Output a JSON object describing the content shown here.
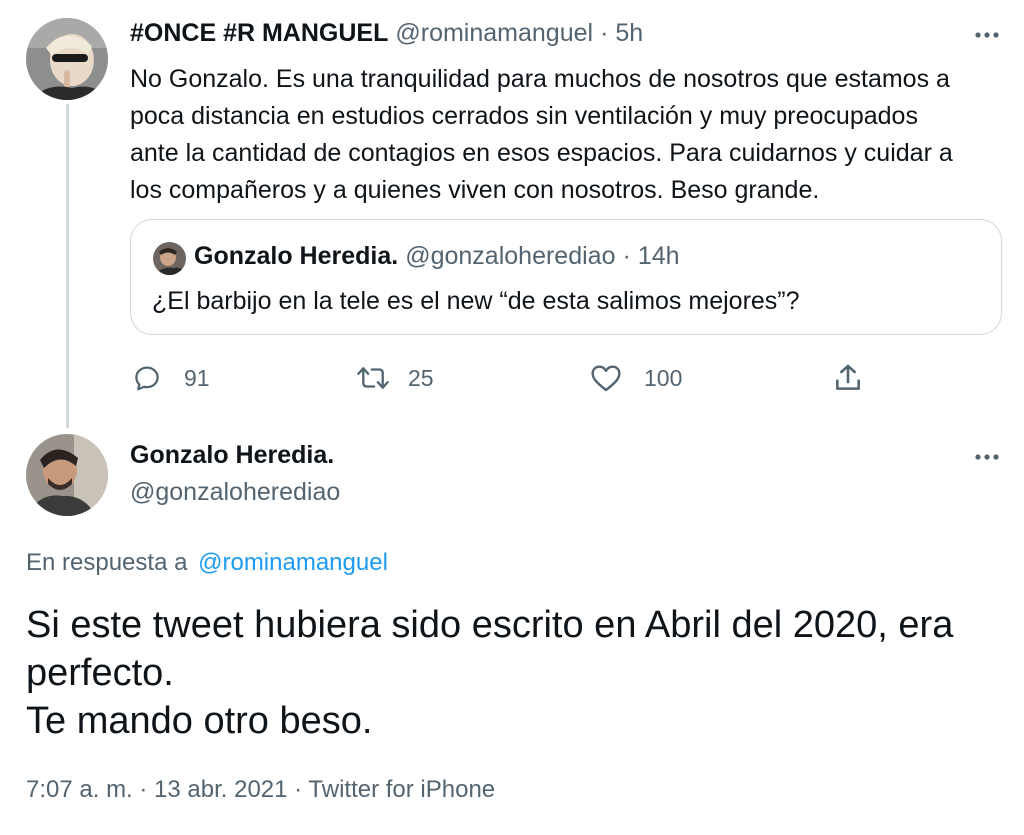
{
  "parent_tweet": {
    "display_name": "#ONCE #R MANGUEL",
    "handle": "@rominamanguel",
    "separator": "·",
    "time": "5h",
    "text_lines": [
      "No Gonzalo. Es una tranquilidad para muchos de nosotros que estamos a",
      "poca distancia en estudios cerrados sin ventilación y muy preocupados",
      "ante la cantidad de contagios en esos espacios. Para cuidarnos y cuidar a",
      "los compañeros y a quienes viven con nosotros. Beso grande."
    ],
    "quote": {
      "display_name": "Gonzalo Heredia.",
      "handle": "@gonzaloherediao",
      "separator": "·",
      "time": "14h",
      "text": "¿El barbijo en la tele es el new “de esta salimos mejores”?"
    },
    "actions": {
      "replies": "91",
      "retweets": "25",
      "likes": "100"
    },
    "more_icon": "more-dots-icon"
  },
  "main_tweet": {
    "display_name": "Gonzalo Heredia.",
    "handle": "@gonzaloherediao",
    "reply_prefix": "En respuesta a",
    "reply_to": "@rominamanguel",
    "text_lines": [
      "Si este tweet hubiera sido escrito en Abril del 2020, era",
      "perfecto.",
      "Te mando otro beso."
    ],
    "timestamp": "7:07 a. m. · 13 abr. 2021 · Twitter for iPhone",
    "more_icon": "more-dots-icon"
  },
  "colors": {
    "text": "#0f1419",
    "muted": "#536471",
    "link": "#1d9bf0",
    "border": "#cfd9de"
  }
}
